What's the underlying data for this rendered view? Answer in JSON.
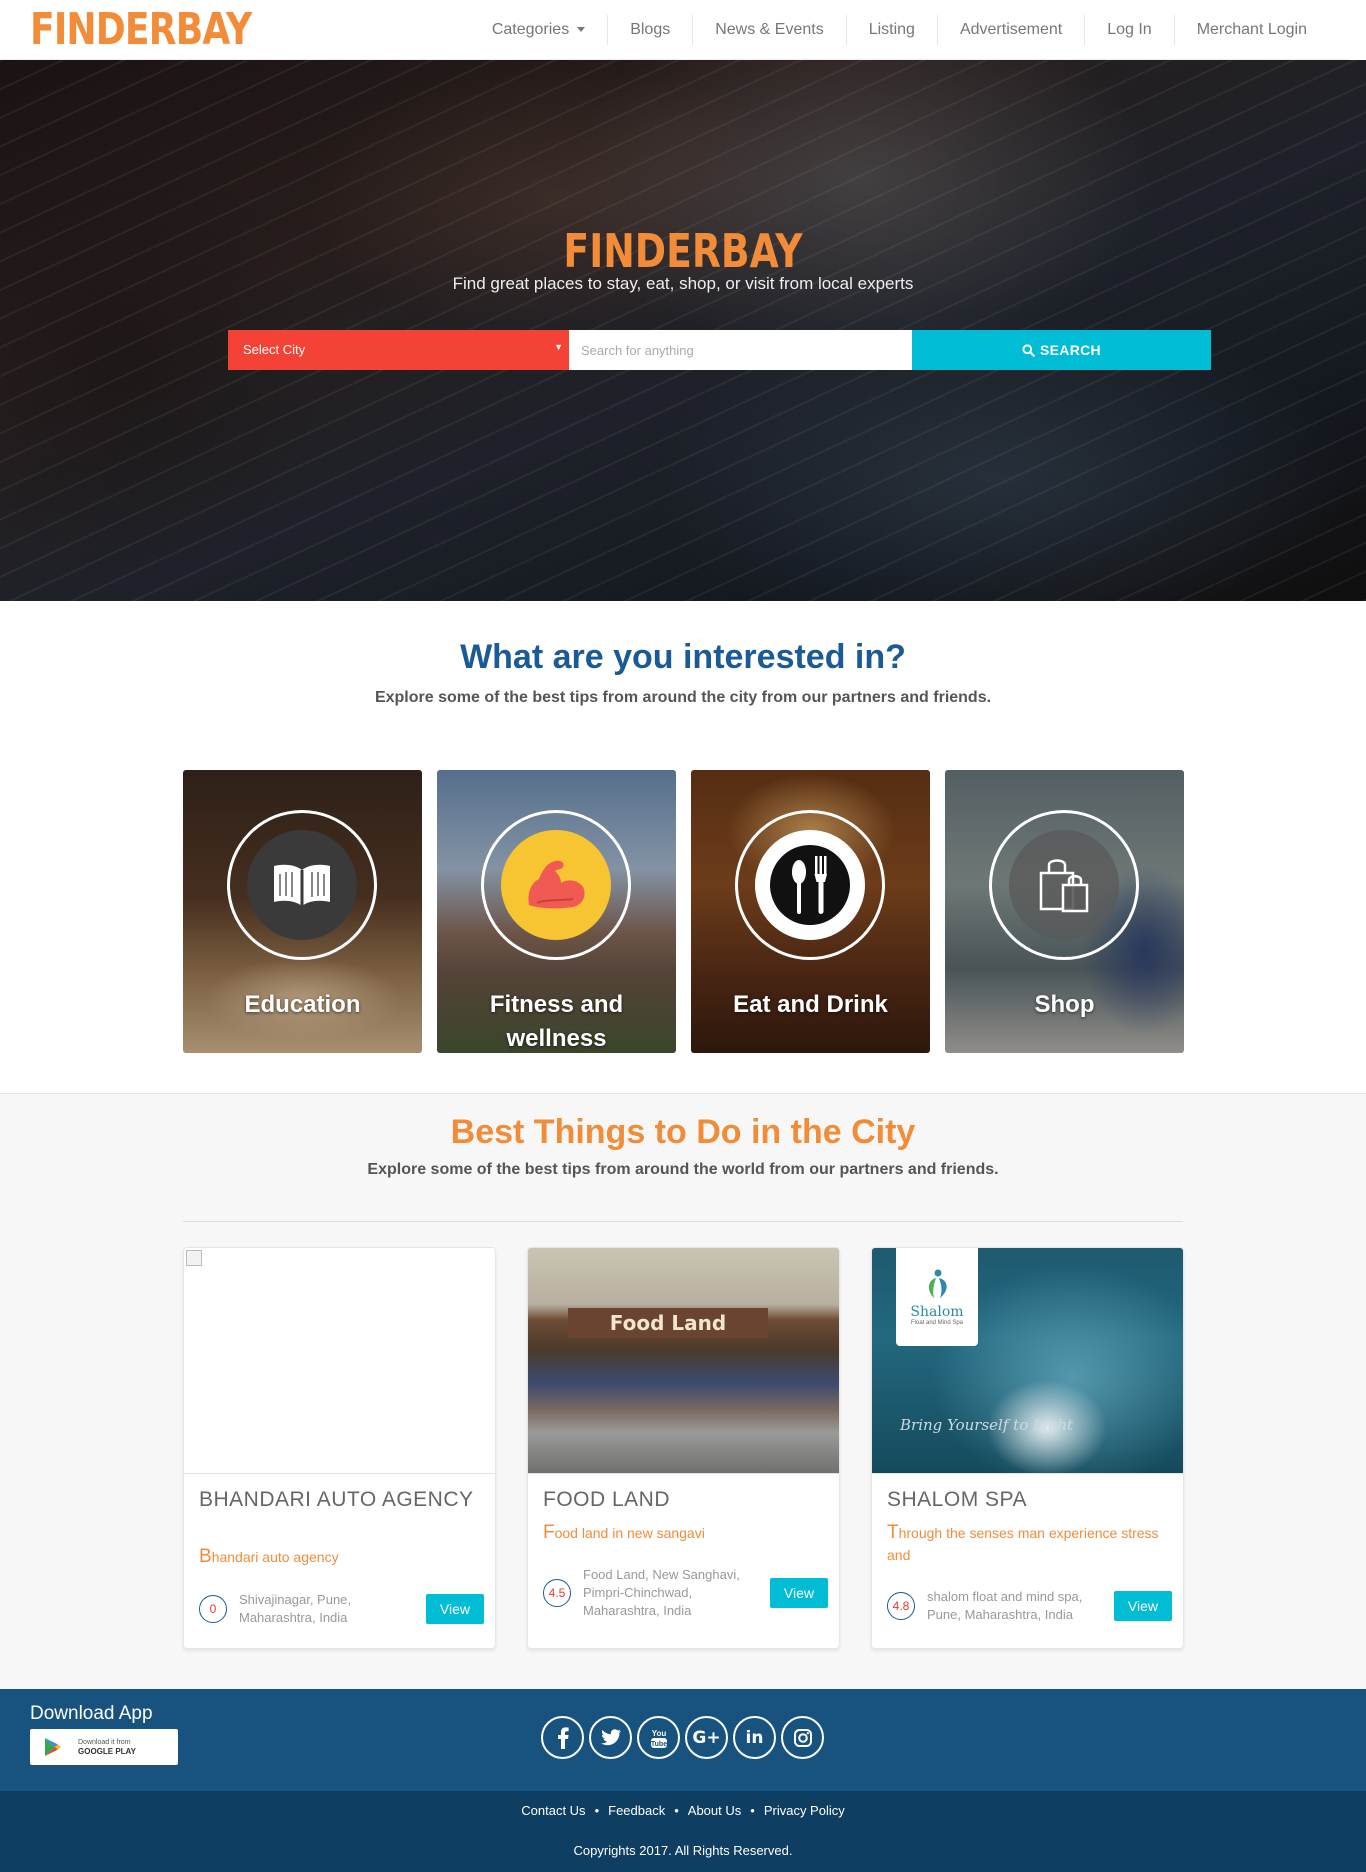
{
  "header": {
    "logo": "FINDERBAY",
    "nav": [
      "Categories",
      "Blogs",
      "News & Events",
      "Listing",
      "Advertisement",
      "Log In",
      "Merchant Login"
    ]
  },
  "hero": {
    "logo": "FINDERBAY",
    "tagline": "Find great places to stay, eat, shop, or visit from local experts",
    "city_select": "Select City",
    "search_placeholder": "Search for anything",
    "search_button": "SEARCH"
  },
  "interests": {
    "title": "What are you interested in?",
    "subtitle": "Explore some of the best tips from around the city from our partners and friends.",
    "categories": [
      {
        "label": "Education",
        "icon": "book-icon"
      },
      {
        "label": "Fitness and wellness",
        "icon": "flexed-arm-icon"
      },
      {
        "label": "Eat and Drink",
        "icon": "spoon-fork-icon"
      },
      {
        "label": "Shop",
        "icon": "shopping-bags-icon"
      }
    ]
  },
  "best": {
    "title": "Best Things to Do in the City",
    "subtitle": "Explore some of the best tips from around the world from our partners and friends.",
    "listings": [
      {
        "title": "BHANDARI AUTO AGENCY",
        "desc_first": "B",
        "desc_rest": "handari auto agency",
        "rating": "0",
        "address": "Shivajinagar, Pune, Maharashtra, India",
        "button": "View"
      },
      {
        "title": "FOOD LAND",
        "desc_first": "F",
        "desc_rest": "ood land in  new sangavi",
        "rating": "4.5",
        "address": "Food Land, New Sanghavi, Pimpri-Chinchwad, Maharashtra, India",
        "button": "View",
        "image_sign": "Food Land"
      },
      {
        "title": "SHALOM SPA",
        "desc_first": "T",
        "desc_rest": "hrough the senses man experience stress and",
        "rating": "4.8",
        "address": "shalom float and mind spa, Pune, Maharashtra, India",
        "button": "View",
        "image_logo": "Shalom",
        "image_logo_sub": "Float and Mind Spa",
        "image_script": "Bring Yourself to Light"
      }
    ]
  },
  "footer": {
    "download_title": "Download App",
    "badge_small": "Download it from",
    "badge_big": "GOOGLE PLAY",
    "socials": [
      "facebook-icon",
      "twitter-icon",
      "youtube-icon",
      "google-plus-icon",
      "linkedin-icon",
      "instagram-icon"
    ],
    "links": [
      "Contact Us",
      "Feedback",
      "About Us",
      "Privacy Policy"
    ],
    "copyright": "Copyrights 2017. All Rights Reserved."
  },
  "colors": {
    "brand_orange": "#f28c38",
    "heading_blue": "#1a5a96",
    "accent_cyan": "#00bcd4",
    "select_red": "#f44336",
    "footer_blue": "#18527f",
    "footer_dark": "#0f3e63"
  }
}
